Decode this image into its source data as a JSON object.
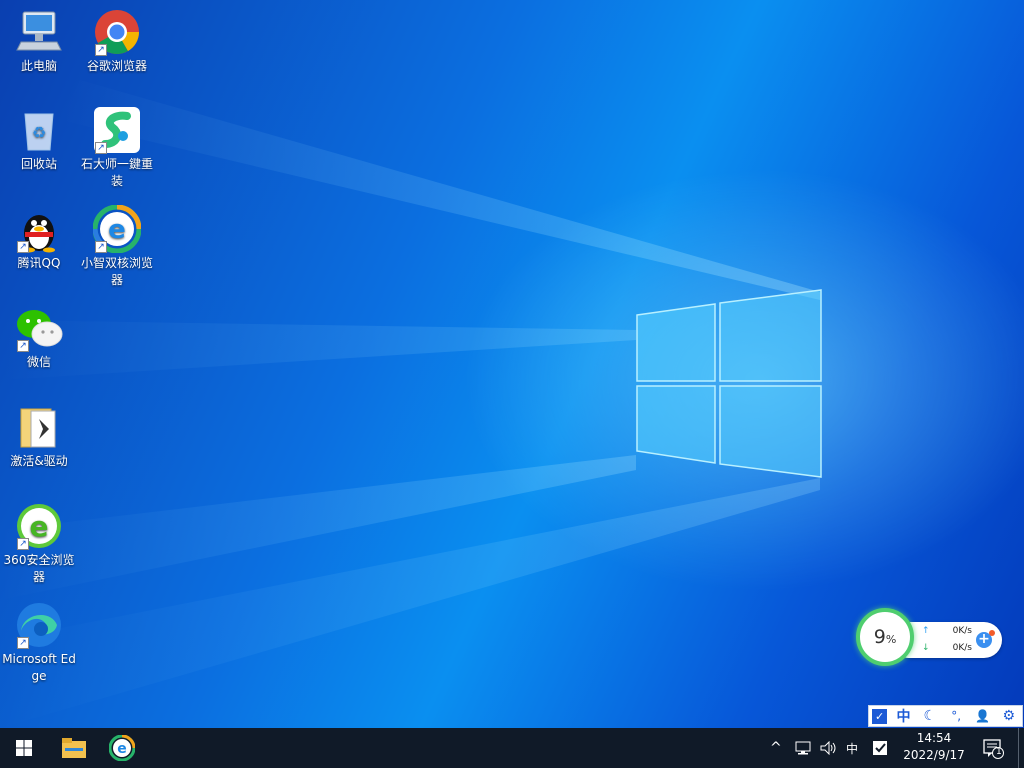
{
  "desktop": {
    "icons": [
      {
        "id": "this-pc",
        "label": "此电脑",
        "icon": "computer-icon"
      },
      {
        "id": "chrome",
        "label": "谷歌浏览器",
        "icon": "chrome-icon"
      },
      {
        "id": "recycle-bin",
        "label": "回收站",
        "icon": "recycle-bin-icon"
      },
      {
        "id": "dashi",
        "label": "石大师一鍵重装",
        "icon": "shidashi-icon"
      },
      {
        "id": "qq",
        "label": "腾讯QQ",
        "icon": "qq-penguin-icon"
      },
      {
        "id": "xiaozhi",
        "label": "小智双核浏览器",
        "icon": "xiaozhi-browser-icon"
      },
      {
        "id": "wechat",
        "label": "微信",
        "icon": "wechat-icon"
      },
      {
        "id": "activate",
        "label": "激活&驱动",
        "icon": "folder-icon"
      },
      {
        "id": "360",
        "label": "360安全浏览器",
        "icon": "360-browser-icon"
      },
      {
        "id": "edge",
        "label": "Microsoft Edge",
        "icon": "edge-icon"
      }
    ]
  },
  "net_widget": {
    "usage_value": "9",
    "usage_unit": "%",
    "up_speed": "0K/s",
    "down_speed": "0K/s",
    "add_label": "+",
    "ring_color": "#4fce6f"
  },
  "ime_bar": {
    "items": [
      {
        "icon": "ime-logo-icon",
        "label": "✓"
      },
      {
        "icon": "chinese-mode-icon",
        "label": "中"
      },
      {
        "icon": "moon-icon",
        "label": "☾"
      },
      {
        "icon": "punctuation-icon",
        "label": "°,"
      },
      {
        "icon": "user-icon",
        "label": "👤"
      },
      {
        "icon": "settings-gear-icon",
        "label": "⚙"
      }
    ]
  },
  "taskbar": {
    "start_icon": "windows-start-icon",
    "pinned": [
      {
        "id": "explorer",
        "icon": "file-explorer-icon"
      },
      {
        "id": "xiaozhi",
        "icon": "xiaozhi-browser-icon"
      }
    ],
    "tray": {
      "chevron": "^",
      "ime_mode": "中",
      "clock_time": "14:54",
      "clock_date": "2022/9/17",
      "notification_count": "1"
    }
  }
}
